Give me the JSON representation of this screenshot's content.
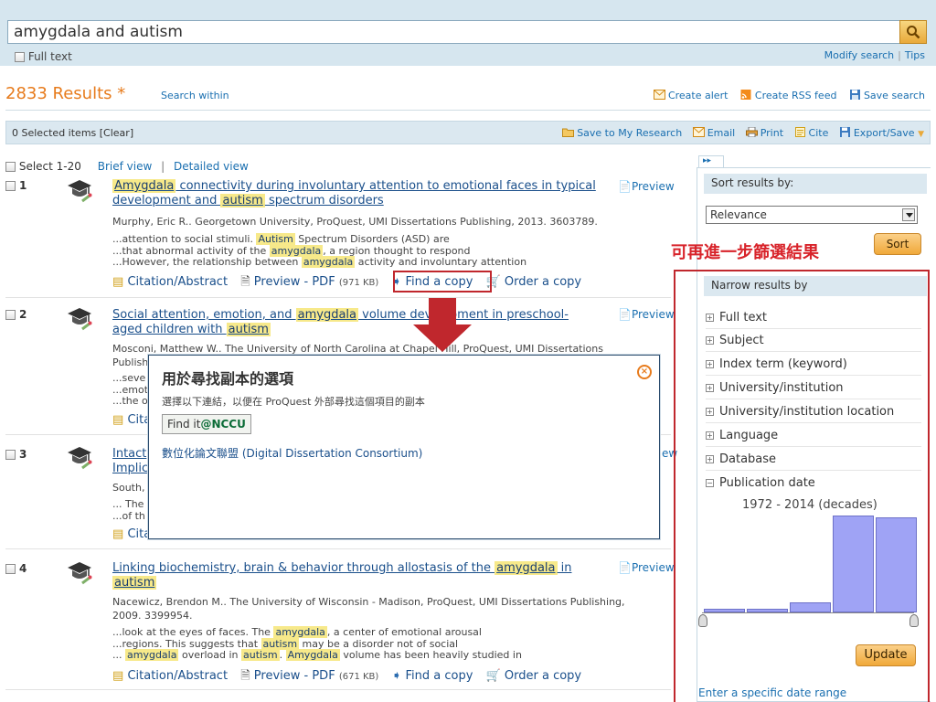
{
  "search": {
    "query": "amygdala and autism",
    "full_text_label": "Full text",
    "modify_search": "Modify search",
    "tips": "Tips"
  },
  "results_header": {
    "count_text": "2833 Results",
    "star": "*",
    "search_within": "Search within",
    "create_alert": "Create alert",
    "create_rss": "Create RSS feed",
    "save_search": "Save search"
  },
  "selection_bar": {
    "selected": "0 Selected items",
    "clear": "[Clear]",
    "save_to_research": "Save to My Research",
    "email": "Email",
    "print": "Print",
    "cite": "Cite",
    "export": "Export/Save"
  },
  "view": {
    "select_range": "Select 1-20",
    "brief": "Brief view",
    "sep": "|",
    "detailed": "Detailed view"
  },
  "results": [
    {
      "num": "1",
      "title_parts": [
        "Amygdala",
        " connectivity during involuntary attention to emotional faces in typical development and ",
        "autism",
        " spectrum disorders"
      ],
      "meta": "Murphy, Eric R.. Georgetown University, ProQuest, UMI Dissertations Publishing, 2013. 3603789.",
      "snippets": [
        [
          "...attention to social stimuli. ",
          "Autism",
          " Spectrum Disorders (ASD) are"
        ],
        [
          "...that abnormal activity of the ",
          "amygdala",
          ", a region thought to respond"
        ],
        [
          "...However, the relationship between ",
          "amygdala",
          " activity and involuntary attention"
        ]
      ],
      "citation": "Citation/Abstract",
      "preview_pdf": "Preview - PDF",
      "pdf_size": "(971 KB)",
      "find_copy": "Find a copy",
      "order_copy": "Order a copy",
      "preview": "Preview"
    },
    {
      "num": "2",
      "title_parts": [
        "Social attention, emotion, and ",
        "amygdala",
        " volume development in preschool-aged children with ",
        "autism"
      ],
      "meta": "Mosconi, Matthew W.. The University of North Carolina at Chapel Hill, ProQuest, UMI Dissertations",
      "meta2": "Publish",
      "snippets": [
        [
          "...seve",
          "",
          ""
        ],
        [
          "...emot",
          "",
          ""
        ],
        [
          "...the o",
          "",
          ""
        ]
      ],
      "citation": "Cita",
      "preview": "Preview"
    },
    {
      "num": "3",
      "title_parts": [
        "Intact ",
        "",
        ""
      ],
      "title_line2": "Implic",
      "meta": "South,",
      "snippets": [
        [
          "... The ",
          "",
          ""
        ],
        [
          "...of th",
          "",
          ""
        ]
      ],
      "citation": "Cita",
      "preview_tail": "ew"
    },
    {
      "num": "4",
      "title_parts": [
        "Linking biochemistry, brain & behavior through allostasis of the ",
        "amygdala",
        " in ",
        "autism"
      ],
      "meta": "Nacewicz, Brendon M.. The University of Wisconsin - Madison, ProQuest, UMI Dissertations Publishing,",
      "meta2": "2009. 3399954.",
      "snippets": [
        [
          "...look at the eyes of faces. The ",
          "amygdala",
          ", a center of emotional arousal"
        ],
        [
          "...regions. This suggests that ",
          "autism",
          " may be a disorder not of social"
        ],
        [
          "... ",
          "amygdala",
          " overload in ",
          "autism",
          ". ",
          "Amygdala",
          " volume has been heavily studied in"
        ]
      ],
      "citation": "Citation/Abstract",
      "preview_pdf": "Preview - PDF",
      "pdf_size": "(671 KB)",
      "find_copy": "Find a copy",
      "order_copy": "Order a copy",
      "preview": "Preview"
    }
  ],
  "popup": {
    "title": "用於尋找副本的選項",
    "description": "選擇以下連結，以便在 ProQuest 外部尋找這個項目的副本",
    "findit_prefix": "Find it",
    "findit_suffix": "@NCCU",
    "link": "數位化論文聯盟 (Digital Dissertation Consortium)",
    "close": "×"
  },
  "sidebar": {
    "tab": "▸▸",
    "sort_header": "Sort results by:",
    "sort_value": "Relevance",
    "sort_button": "Sort",
    "annotation": "可再進一步篩選結果",
    "narrow_header": "Narrow results by",
    "facets": [
      {
        "sign": "+",
        "label": "Full text"
      },
      {
        "sign": "+",
        "label": "Subject"
      },
      {
        "sign": "+",
        "label": "Index term (keyword)"
      },
      {
        "sign": "+",
        "label": "University/institution"
      },
      {
        "sign": "+",
        "label": "University/institution location"
      },
      {
        "sign": "+",
        "label": "Language"
      },
      {
        "sign": "+",
        "label": "Database"
      },
      {
        "sign": "−",
        "label": "Publication date"
      }
    ],
    "date_range": "1972 - 2014 (decades)",
    "histogram": [
      0.04,
      0.04,
      0.1,
      1.0,
      0.98
    ],
    "update_button": "Update",
    "enter_date": "Enter a specific date range"
  },
  "colors": {
    "accent_orange": "#e77b1c",
    "highlight": "#f7e98a",
    "annotation_red": "#c0272d",
    "link_blue": "#1a4f8b"
  }
}
